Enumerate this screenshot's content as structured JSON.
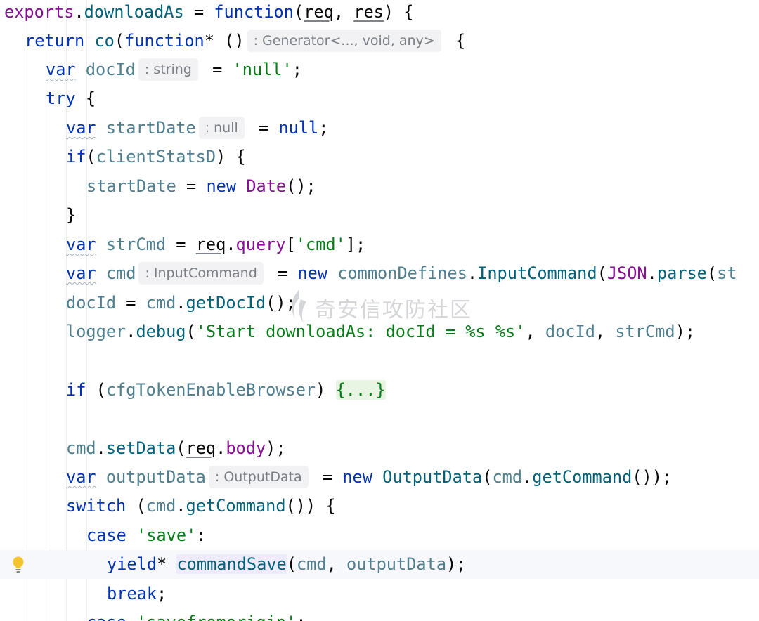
{
  "editor": {
    "lines": {
      "l1": {
        "exports": "exports",
        "downloadAs": "downloadAs",
        "eq": " = ",
        "function": "function",
        "p1": "(",
        "req": "req",
        "comma": ", ",
        "res": "res",
        "p2": ") {"
      },
      "l2": {
        "return": "return",
        "sp": " ",
        "co": "co",
        "p1": "(",
        "function": "function",
        "star": "* ()",
        "hint": ": Generator<..., void, any>",
        "brace": " {"
      },
      "l3": {
        "var": "var",
        "docId": "docId",
        "hint": ": string",
        "eq": " = ",
        "val": "'null'",
        "semi": ";"
      },
      "l4": {
        "try": "try",
        "brace": " {"
      },
      "l5": {
        "var": "var",
        "startDate": "startDate",
        "hint": ": null",
        "eq": " = ",
        "null": "null",
        "semi": ";"
      },
      "l6": {
        "if": "if",
        "p1": "(",
        "clientStatsD": "clientStatsD",
        "p2": ") {"
      },
      "l7": {
        "startDate": "startDate",
        "eq": " = ",
        "new": "new",
        "Date": "Date",
        "tail": "();"
      },
      "l8": {
        "brace": "}"
      },
      "l9": {
        "var": "var",
        "strCmd": "strCmd",
        "eq": " = ",
        "req": "req",
        "dot": ".",
        "query": "query",
        "b1": "[",
        "cmd": "'cmd'",
        "b2": "];"
      },
      "l10": {
        "var": "var",
        "cmd": "cmd",
        "hint": ": InputCommand",
        "eq": " = ",
        "new": "new",
        "commonDefines": "commonDefines",
        "dot": ".",
        "InputCommand": "InputCommand",
        "p1": "(",
        "JSON": "JSON",
        "dot2": ".",
        "parse": "parse",
        "p2": "(",
        "st": "st"
      },
      "l11": {
        "docId": "docId",
        "eq": " = ",
        "cmd": "cmd",
        "dot": ".",
        "getDocId": "getDocId",
        "tail": "();"
      },
      "l12": {
        "logger": "logger",
        "dot": ".",
        "debug": "debug",
        "p1": "(",
        "str": "'Start downloadAs: docId = %s %s'",
        "comma": ", ",
        "docId": "docId",
        "comma2": ", ",
        "strCmd": "strCmd",
        "tail": ");"
      },
      "l14": {
        "if": "if",
        "p1": " (",
        "cfg": "cfgTokenEnableBrowser",
        "p2": ") ",
        "fold": "{...}"
      },
      "l16": {
        "cmd": "cmd",
        "dot": ".",
        "setData": "setData",
        "p1": "(",
        "req": "req",
        "dot2": ".",
        "body": "body",
        "tail": ");"
      },
      "l17": {
        "var": "var",
        "outputData": "outputData",
        "hint": ": OutputData",
        "eq": " = ",
        "new": "new",
        "OutputData": "OutputData",
        "p1": "(",
        "cmd": "cmd",
        "dot": ".",
        "getCommand": "getCommand",
        "tail": "());"
      },
      "l18": {
        "switch": "switch",
        "p1": " (",
        "cmd": "cmd",
        "dot": ".",
        "getCommand": "getCommand",
        "tail": "()) {"
      },
      "l19": {
        "case": "case",
        "sp": " ",
        "str": "'save'",
        "colon": ":"
      },
      "l20": {
        "yield": "yield",
        "star": "* ",
        "commandSave": "commandSave",
        "p1": "(",
        "cmd": "cmd",
        "comma": ", ",
        "outputData": "outputData",
        "tail": ");"
      },
      "l21": {
        "break": "break",
        "semi": ";"
      },
      "l22": {
        "case": "case",
        "sp": " ",
        "str": "'savefromorigin'",
        "colon": ":"
      }
    },
    "watermark": "奇安信攻防社区",
    "bulb_icon": "lightbulb-icon",
    "colors": {
      "keyword": "#0033b3",
      "string": "#067d17",
      "function": "#00627a",
      "variable": "#4f7f8f",
      "property": "#871094"
    }
  }
}
